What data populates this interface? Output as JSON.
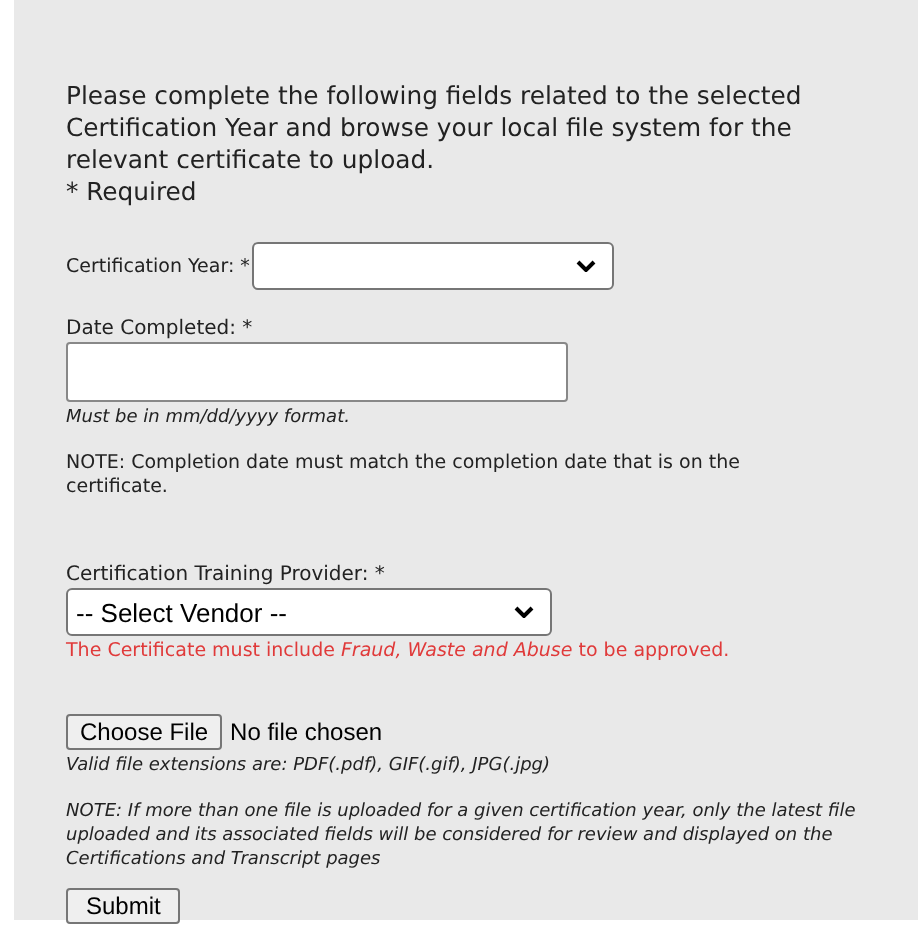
{
  "intro": "Please complete the following fields related to the selected Certification Year and browse your local file system for the relevant certificate to upload.",
  "required_note": "* Required",
  "certification_year": {
    "label": "Certification Year: *"
  },
  "date_completed": {
    "label": "Date Completed: *",
    "hint": "Must be in mm/dd/yyyy format.",
    "note": "NOTE: Completion date must match the completion date that is on the certificate."
  },
  "training_provider": {
    "label": "Certification Training Provider: *",
    "value": "-- Select Vendor --",
    "warning": "The Certificate must include *Fraud, Waste and Abuse* to be approved."
  },
  "file_upload": {
    "button": "Choose File",
    "status": "No file chosen",
    "hint": "Valid file extensions are: PDF(.pdf), GIF(.gif), JPG(.jpg)",
    "note": "NOTE: If more than one file is uploaded for a given certification year, only the latest file uploaded and its associated fields will be considered for review and displayed on the Certifications and Transcript pages"
  },
  "submit": "Submit"
}
